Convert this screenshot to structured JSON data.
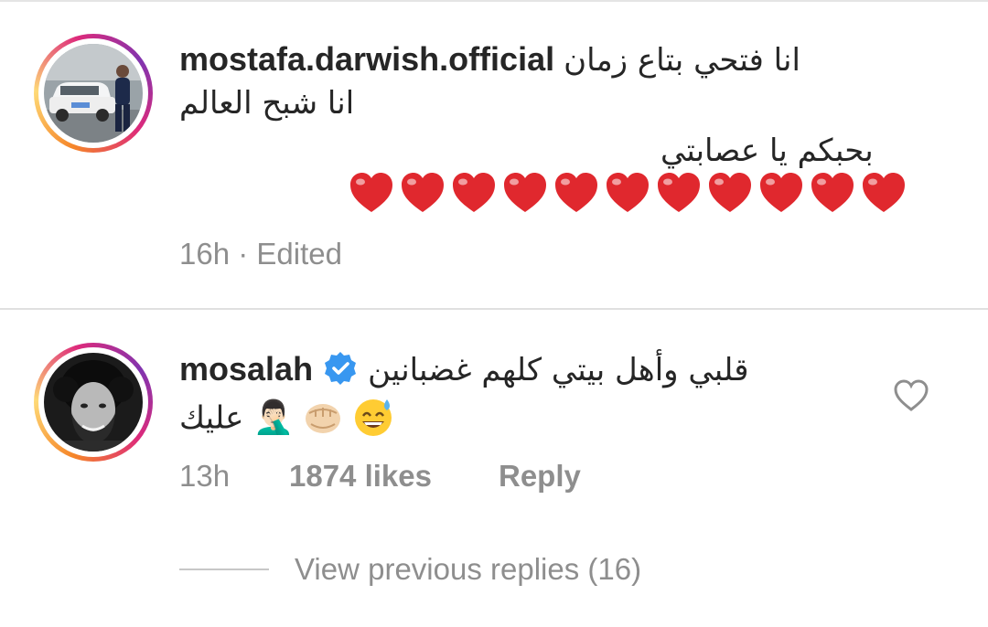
{
  "comments": [
    {
      "username": "mostafa.darwish.official",
      "avatar_icon": "profile-photo-man-with-white-car",
      "text_line_1": "انا فتحي بتاع زمان",
      "text_line_2": "انا شبح العالم",
      "text_line_3": "بحبكم يا عصابتي",
      "hearts": "❤️❤️❤️❤️❤️❤️❤️❤️❤️❤️❤️",
      "heart_count": 11,
      "time": "16h",
      "separator": "·",
      "edited": "Edited"
    },
    {
      "username": "mosalah",
      "verified": true,
      "avatar_icon": "profile-photo-mohamed-salah",
      "text_line_1": "قلبي وأهل بيتي كلهم غضبانين",
      "text_line_2_arabic": "عليك",
      "text_line_2_symbols": "🤦🏻‍♂",
      "text_line_2_emoji": "👊🏻🤦😅",
      "time": "13h",
      "likes": "1874 likes",
      "reply": "Reply",
      "view_previous_replies": "View previous replies (16)"
    }
  ],
  "colors": {
    "text": "#262626",
    "secondary": "#8e8e8e",
    "verified_blue": "#3897f0",
    "heart_red": "#e0282e",
    "divider": "#e0e0e0"
  }
}
